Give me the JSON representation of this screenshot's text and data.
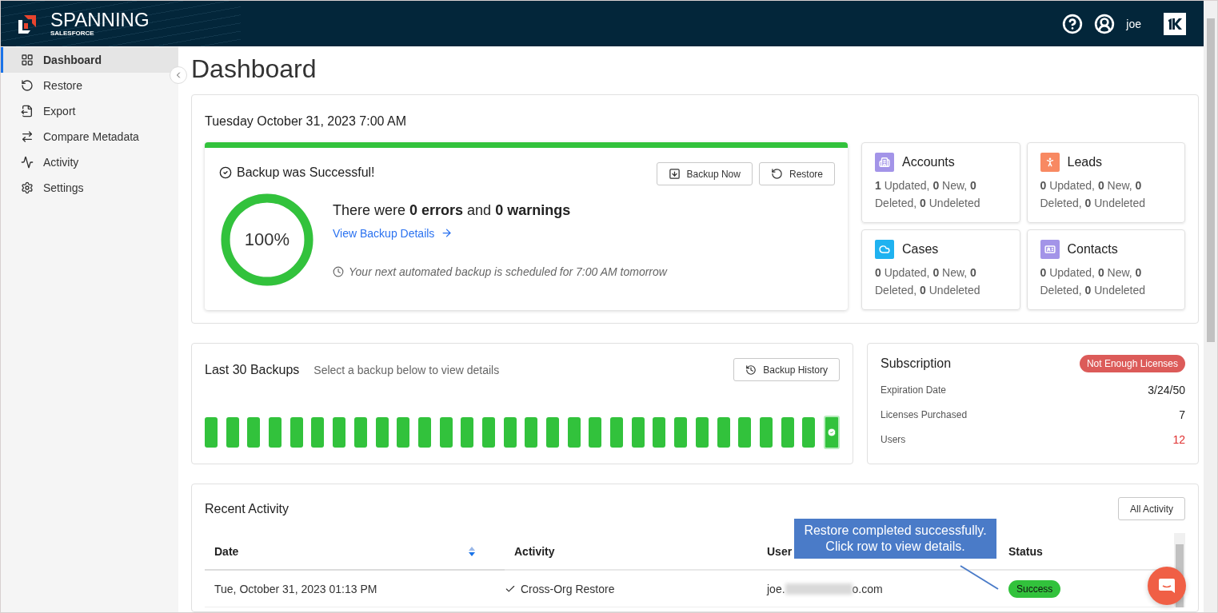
{
  "header": {
    "brand": "SPANNING",
    "brand_sub": "SALESFORCE",
    "user": "joe"
  },
  "sidebar": {
    "items": [
      {
        "label": "Dashboard",
        "selected": true
      },
      {
        "label": "Restore",
        "selected": false
      },
      {
        "label": "Export",
        "selected": false
      },
      {
        "label": "Compare Metadata",
        "selected": false
      },
      {
        "label": "Activity",
        "selected": false
      },
      {
        "label": "Settings",
        "selected": false
      }
    ]
  },
  "page_title": "Dashboard",
  "summary": {
    "date": "Tuesday October 31, 2023 7:00 AM",
    "status": "Backup was Successful!",
    "buttons": [
      "Backup Now",
      "Restore"
    ],
    "progress": {
      "level": 1,
      "reading": "100%"
    },
    "message": "There were **0 errors** and **0 warnings**",
    "details_link": "View Backup Details",
    "next_backup": "Your next automated backup is scheduled for 7:00 AM tomorrow"
  },
  "objects": [
    {
      "name": "Accounts",
      "color": "#a394e8",
      "text": "**1** Updated, **0** New, **0** Deleted, **0** Undeleted"
    },
    {
      "name": "Leads",
      "color": "#f88962",
      "text": "**0** Updated, **0** New, **0** Deleted, **0** Undeleted"
    },
    {
      "name": "Cases",
      "color": "#1fb2f0",
      "text": "**0** Updated, **0** New, **0** Deleted, **0** Undeleted"
    },
    {
      "name": "Contacts",
      "color": "#a394e8",
      "text": "**0** Updated, **0** New, **0** Deleted, **0** Undeleted"
    }
  ],
  "backups": {
    "title": "Last 30 Backups",
    "hint": "Select a backup below to view details",
    "history_button": "Backup History",
    "items": [
      {
        "selected": false
      },
      {
        "selected": false
      },
      {
        "selected": false
      },
      {
        "selected": false
      },
      {
        "selected": false
      },
      {
        "selected": false
      },
      {
        "selected": false
      },
      {
        "selected": false
      },
      {
        "selected": false
      },
      {
        "selected": false
      },
      {
        "selected": false
      },
      {
        "selected": false
      },
      {
        "selected": false
      },
      {
        "selected": false
      },
      {
        "selected": false
      },
      {
        "selected": false
      },
      {
        "selected": false
      },
      {
        "selected": false
      },
      {
        "selected": false
      },
      {
        "selected": false
      },
      {
        "selected": false
      },
      {
        "selected": false
      },
      {
        "selected": false
      },
      {
        "selected": false
      },
      {
        "selected": false
      },
      {
        "selected": false
      },
      {
        "selected": false
      },
      {
        "selected": false
      },
      {
        "selected": false
      },
      {
        "selected": true
      }
    ]
  },
  "subscription": {
    "title": "Subscription",
    "badge": "Not Enough Licenses",
    "rows": [
      {
        "label": "Expiration Date",
        "value": "3/24/50",
        "warning": false
      },
      {
        "label": "Licenses Purchased",
        "value": "7",
        "warning": false
      },
      {
        "label": "Users",
        "value": "12",
        "warning": true
      }
    ]
  },
  "activity": {
    "title": "Recent Activity",
    "all_button": "All Activity",
    "columns": [
      {
        "label": "Date",
        "sorted": true
      },
      {
        "label": "Activity",
        "sorted": false
      },
      {
        "label": "User",
        "sorted": false
      },
      {
        "label": "Status",
        "sorted": false
      }
    ],
    "rows": [
      {
        "date": "Tue, October 31, 2023 01:13 PM",
        "activity": "Cross-Org Restore",
        "user_start": "joe.",
        "user_end": "o.com",
        "status": "Success",
        "kind": "success"
      }
    ],
    "tooltip": "Restore completed successfully.\nClick row to view details."
  }
}
